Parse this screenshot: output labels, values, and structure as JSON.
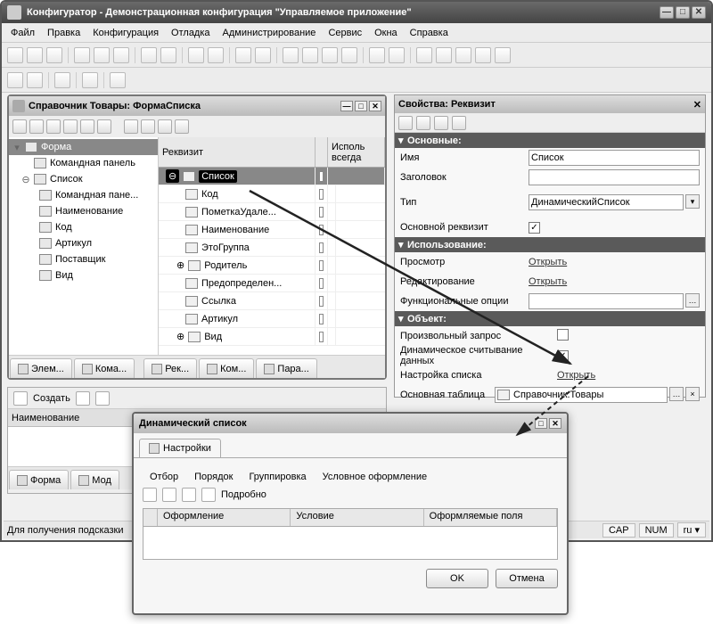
{
  "window": {
    "title": "Конфигуратор - Демонстрационная конфигурация \"Управляемое приложение\""
  },
  "menu": [
    "Файл",
    "Правка",
    "Конфигурация",
    "Отладка",
    "Администрирование",
    "Сервис",
    "Окна",
    "Справка"
  ],
  "form_window": {
    "title": "Справочник Товары: ФормаСписка",
    "tree": {
      "root": "Форма",
      "items": [
        "Командная панель",
        "Список"
      ],
      "sublist": [
        "Командная пане...",
        "Наименование",
        "Код",
        "Артикул",
        "Поставщик",
        "Вид"
      ]
    },
    "grid": {
      "col1": "Реквизит",
      "col2": "Исполь\nвсегда",
      "rows": [
        "Список",
        "Код",
        "ПометкаУдале...",
        "Наименование",
        "ЭтоГруппа",
        "Родитель",
        "Предопределен...",
        "Ссылка",
        "Артикул",
        "Вид"
      ]
    },
    "tabs_left": [
      "Элем...",
      "Кома..."
    ],
    "tabs_right": [
      "Рек...",
      "Ком...",
      "Пара..."
    ],
    "bottom_tabs": [
      "Форма",
      "Мод"
    ]
  },
  "props": {
    "title": "Свойства: Реквизит",
    "sec_main": "Основные:",
    "name_lbl": "Имя",
    "name_val": "Список",
    "title_lbl": "Заголовок",
    "title_val": "",
    "type_lbl": "Тип",
    "type_val": "ДинамическийСписок",
    "mainreq_lbl": "Основной реквизит",
    "sec_use": "Использование:",
    "view_lbl": "Просмотр",
    "open": "Открыть",
    "edit_lbl": "Редактирование",
    "fopts_lbl": "Функциональные опции",
    "sec_obj": "Объект:",
    "arb_lbl": "Произвольный запрос",
    "dynread_lbl": "Динамическое считывание данных",
    "listset_lbl": "Настройка списка",
    "maintab_lbl": "Основная таблица",
    "maintab_val": "Справочник.Товары"
  },
  "listpanel": {
    "create": "Создать",
    "col": "Наименование"
  },
  "status": {
    "hint": "Для получения подсказки",
    "cap": "CAP",
    "num": "NUM",
    "lang": "ru"
  },
  "dialog": {
    "title": "Динамический список",
    "toptab": "Настройки",
    "subtabs": [
      "Отбор",
      "Порядок",
      "Группировка",
      "Условное оформление"
    ],
    "detail": "Подробно",
    "cols": [
      "Оформление",
      "Условие",
      "Оформляемые поля"
    ],
    "ok": "OK",
    "cancel": "Отмена"
  }
}
